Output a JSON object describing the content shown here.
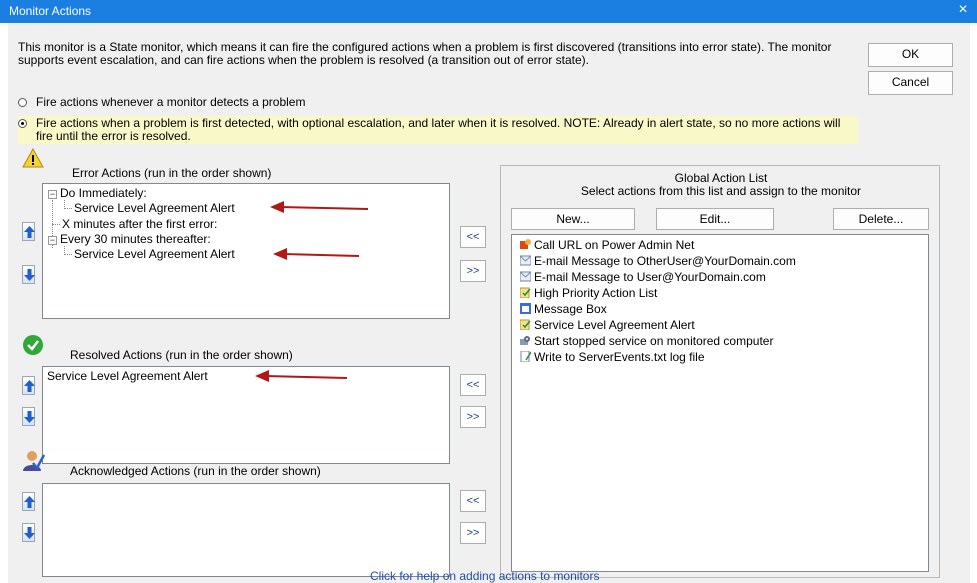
{
  "window": {
    "title": "Monitor Actions",
    "close_glyph": "×"
  },
  "description": "This monitor is a State monitor, which means it can fire the configured actions when a problem is first discovered (transitions into error state).  The monitor supports event escalation, and can fire actions when the problem is resolved (a transition out of error state).",
  "buttons": {
    "ok": "OK",
    "cancel": "Cancel"
  },
  "radio": {
    "option1": "Fire actions whenever a monitor detects a problem",
    "option2": "Fire actions when a problem is first detected, with optional escalation, and later when it is resolved.  NOTE: Already in alert state, so no more actions will fire until the error is resolved.",
    "selected": "option2"
  },
  "error_actions": {
    "title": "Error Actions (run in the order shown)",
    "tree": {
      "group1": "Do Immediately:",
      "group1_item": "Service Level Agreement Alert",
      "group1_sub": "X minutes after the first error:",
      "group2": "Every 30 minutes thereafter:",
      "group2_item": "Service Level Agreement Alert"
    }
  },
  "resolved_actions": {
    "title": "Resolved Actions (run in the order shown)",
    "item": "Service Level Agreement Alert"
  },
  "acknowledged_actions": {
    "title": "Acknowledged Actions (run in the order shown)"
  },
  "move_buttons": {
    "assign": "<<",
    "remove": ">>"
  },
  "global": {
    "title": "Global Action List",
    "subtitle": "Select actions from this list and assign to the monitor",
    "new": "New...",
    "edit": "Edit...",
    "delete": "Delete...",
    "items": [
      {
        "label": "Call URL on Power Admin Net",
        "icon": "url-icon"
      },
      {
        "label": "E-mail Message to OtherUser@YourDomain.com",
        "icon": "email-icon"
      },
      {
        "label": "E-mail Message to User@YourDomain.com",
        "icon": "email-icon"
      },
      {
        "label": "High Priority Action List",
        "icon": "action-list-icon"
      },
      {
        "label": "Message Box",
        "icon": "message-box-icon"
      },
      {
        "label": "Service Level Agreement Alert",
        "icon": "action-list-icon"
      },
      {
        "label": "Start stopped service on monitored computer",
        "icon": "service-icon"
      },
      {
        "label": "Write to ServerEvents.txt log file",
        "icon": "log-file-icon"
      }
    ]
  },
  "help_link": "Click for help on adding actions to monitors",
  "colors": {
    "titlebar": "#1a7fe0",
    "note_bg": "#f8f8c8",
    "arrow": "#b01818",
    "link": "#1f4fa8"
  }
}
